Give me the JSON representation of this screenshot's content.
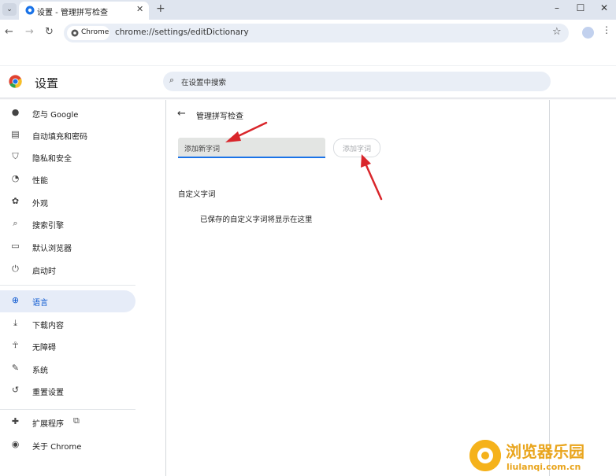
{
  "browser": {
    "tab_title": "设置 - 管理拼写检查",
    "url": "chrome://settings/editDictionary",
    "chip_label": "Chrome"
  },
  "header": {
    "title": "设置",
    "search_placeholder": "在设置中搜索"
  },
  "sidebar": {
    "items": [
      {
        "label": "您与 Google",
        "icon": "person-icon"
      },
      {
        "label": "自动填充和密码",
        "icon": "clipboard-icon"
      },
      {
        "label": "隐私和安全",
        "icon": "shield-icon"
      },
      {
        "label": "性能",
        "icon": "speedometer-icon"
      },
      {
        "label": "外观",
        "icon": "palette-icon"
      },
      {
        "label": "搜索引擎",
        "icon": "search-icon"
      },
      {
        "label": "默认浏览器",
        "icon": "browser-icon"
      },
      {
        "label": "启动时",
        "icon": "power-icon"
      },
      {
        "label": "语言",
        "icon": "globe-icon"
      },
      {
        "label": "下载内容",
        "icon": "download-icon"
      },
      {
        "label": "无障碍",
        "icon": "accessibility-icon"
      },
      {
        "label": "系统",
        "icon": "wrench-icon"
      },
      {
        "label": "重置设置",
        "icon": "reset-icon"
      },
      {
        "label": "扩展程序",
        "icon": "puzzle-icon"
      },
      {
        "label": "关于 Chrome",
        "icon": "chrome-icon"
      }
    ],
    "active_item": "语言"
  },
  "main": {
    "page_heading": "管理拼写检查",
    "input_placeholder": "添加新字词",
    "add_button": "添加字词",
    "custom_words_heading": "自定义字词",
    "empty_message": "已保存的自定义字词将显示在这里"
  },
  "watermark": {
    "title": "浏览器乐园",
    "url": "liulanqi.com.cn"
  },
  "colors": {
    "accent": "#1a73e8",
    "tabstrip": "#dfe5ef",
    "annotation_arrow": "#d9262b",
    "watermark": "#e9a51d"
  }
}
